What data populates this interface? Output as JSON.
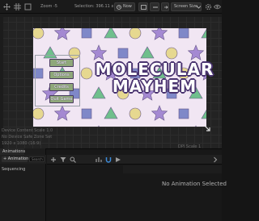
{
  "toolbar": {
    "zoom": "Zoom -5",
    "selection": "Selection: 396.11 x 539.82",
    "now_label": "Now",
    "screen_size_label": "Screen Size",
    "accent_color": "#2a7bd4"
  },
  "preview": {
    "background_color": "#f1e6f3",
    "title_line1": "MOLECULAR",
    "title_line2": "MAYHEM",
    "title_color": "#ffffff",
    "title_outline_color": "#4a3470",
    "menu_items": [
      "Start",
      "Options",
      "Credits",
      "Quit Game"
    ],
    "menu_button_color": "#8fa87a",
    "shape_colors": {
      "circle": "#e6d890",
      "triangle": "#6fbf8c",
      "square": "#7f88c8",
      "star": "#a489d2"
    }
  },
  "canvas_info": {
    "device_content_scale": "Device Content Scale 1.0",
    "safe_zone": "No Device Safe Zone Set",
    "resolution": "1920 x 1080 (16:9)",
    "dpi_scale": "DPI Scale 1"
  },
  "animations_panel": {
    "tab_label": "Animations",
    "add_button": "+ Animation",
    "search_placeholder": "Search",
    "row_label": "Sequencing"
  },
  "timeline": {
    "empty_message": "No Animation Selected"
  }
}
